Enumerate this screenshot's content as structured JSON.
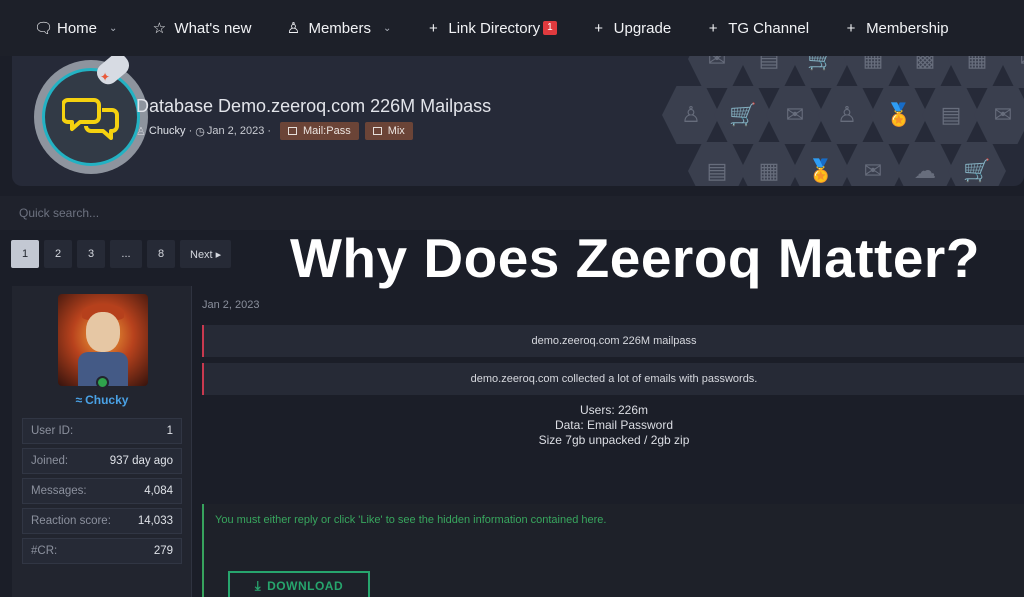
{
  "nav": {
    "items": [
      {
        "label": "Home",
        "icon": "chat-bubble-icon"
      },
      {
        "label": "What's new",
        "icon": "star-icon"
      },
      {
        "label": "Members",
        "icon": "users-icon"
      },
      {
        "label": "Link Directory",
        "icon": "plus-icon",
        "badge": "1"
      },
      {
        "label": "Upgrade",
        "icon": "plus-icon"
      },
      {
        "label": "TG Channel",
        "icon": "plus-icon"
      },
      {
        "label": "Membership",
        "icon": "plus-icon"
      }
    ]
  },
  "thread": {
    "title": "Database Demo.zeeroq.com 226M Mailpass",
    "author": "Chucky",
    "date": "Jan 2, 2023",
    "tags": [
      "Mail:Pass",
      "Mix"
    ]
  },
  "search": {
    "placeholder": "Quick search..."
  },
  "pagination": {
    "pages": [
      "1",
      "2",
      "3",
      "...",
      "8"
    ],
    "next_label": "Next ▸",
    "current": "1"
  },
  "overlay": {
    "headline": "Why Does Zeeroq Matter?"
  },
  "user": {
    "name": "Chucky",
    "stats": [
      {
        "label": "User ID:",
        "value": "1"
      },
      {
        "label": "Joined:",
        "value": "937 day ago"
      },
      {
        "label": "Messages:",
        "value": "4,084"
      },
      {
        "label": "Reaction score:",
        "value": "14,033"
      },
      {
        "label": "#CR:",
        "value": "279"
      }
    ]
  },
  "post": {
    "date": "Jan 2, 2023",
    "line1": "demo.zeeroq.com 226M mailpass",
    "line2": "demo.zeeroq.com collected a lot of emails with passwords.",
    "users": "Users: 226m",
    "data": "Data: Email Password",
    "size": "Size 7gb unpacked / 2gb zip",
    "hidden_notice": "You must either reply or click 'Like' to see the hidden information contained here.",
    "download_label": "DOWNLOAD"
  },
  "colors": {
    "accent_red": "#c9394f",
    "accent_green": "#27a56d",
    "tag_brown": "#6b4437",
    "username_blue": "#4aa2e6"
  }
}
